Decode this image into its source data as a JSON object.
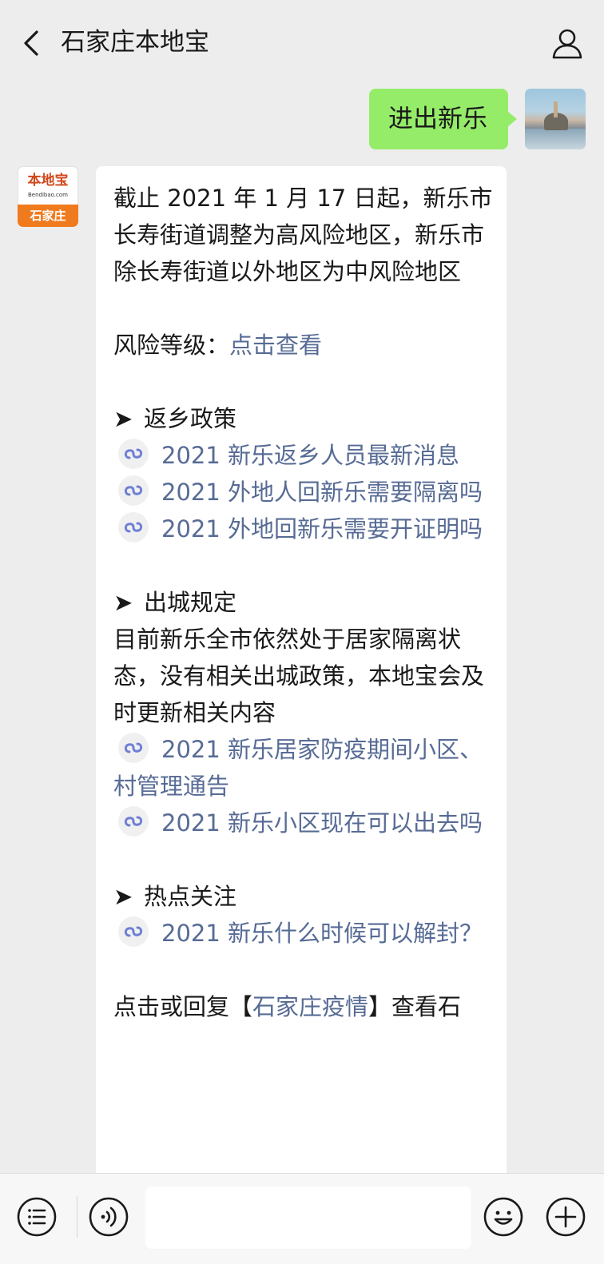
{
  "header": {
    "title": "石家庄本地宝"
  },
  "outgoing": {
    "text": "进出新乐"
  },
  "bot_avatar": {
    "logo_text": "本地宝",
    "logo_sub": "Bendibao.com",
    "city": "石家庄"
  },
  "message": {
    "intro": "截止 2021 年 1 月 17 日起，新乐市长寿街道调整为高风险地区，新乐市除长寿街道以外地区为中风险地区",
    "risk_label": "风险等级：",
    "risk_link": "点击查看",
    "sections": [
      {
        "head": "返乡政策",
        "links": [
          "2021 新乐返乡人员最新消息",
          "2021 外地人回新乐需要隔离吗",
          "2021 外地回新乐需要开证明吗"
        ]
      },
      {
        "head": "出城规定",
        "body": "目前新乐全市依然处于居家隔离状态，没有相关出城政策，本地宝会及时更新相关内容",
        "links": [
          "2021 新乐居家防疫期间小区、村管理通告",
          "2021 新乐小区现在可以出去吗"
        ]
      },
      {
        "head": "热点关注",
        "links": [
          "2021 新乐什么时候可以解封？"
        ]
      }
    ],
    "footer_pre": "点击或回复【",
    "footer_link": "石家庄疫情",
    "footer_post": "】查看石"
  },
  "colors": {
    "background": "#ededed",
    "outgoing_bubble": "#95ec69",
    "link": "#576b95",
    "bot_city_bar": "#f07a1e"
  },
  "icons": {
    "back": "chevron-left-icon",
    "profile": "person-icon",
    "menu": "menu-list-icon",
    "voice": "voice-icon",
    "emoji": "emoji-icon",
    "more": "plus-icon",
    "mini_program_link": "mini-program-link-icon"
  }
}
